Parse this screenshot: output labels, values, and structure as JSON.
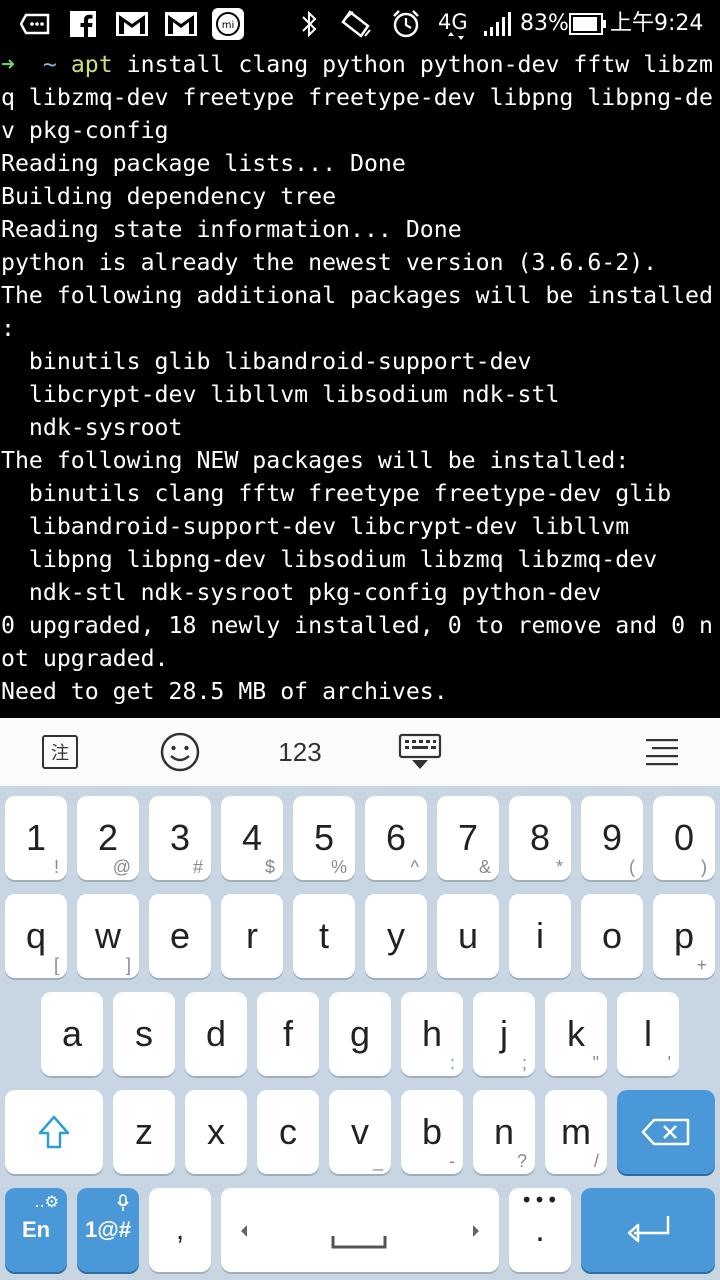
{
  "status_bar": {
    "icons": [
      "message-icon",
      "facebook-icon",
      "gmail-icon",
      "gmail-icon",
      "mi-icon",
      "bluetooth-icon",
      "rotate-icon",
      "alarm-icon"
    ],
    "network": "4G",
    "battery": "83%",
    "time": "上午9:24"
  },
  "terminal": {
    "prompt_arrow": "➜",
    "prompt_dir": "~",
    "command_name": "apt",
    "command_rest": " install clang python python-dev fftw libzm",
    "lines": [
      "q libzmq-dev freetype freetype-dev libpng libpng-de",
      "v pkg-config",
      "Reading package lists... Done",
      "Building dependency tree",
      "Reading state information... Done",
      "python is already the newest version (3.6.6-2).",
      "The following additional packages will be installed",
      ":",
      "  binutils glib libandroid-support-dev",
      "  libcrypt-dev libllvm libsodium ndk-stl",
      "  ndk-sysroot",
      "The following NEW packages will be installed:",
      "  binutils clang fftw freetype freetype-dev glib",
      "  libandroid-support-dev libcrypt-dev libllvm",
      "  libpng libpng-dev libsodium libzmq libzmq-dev",
      "  ndk-stl ndk-sysroot pkg-config python-dev",
      "0 upgraded, 18 newly installed, 0 to remove and 0 n",
      "ot upgraded.",
      "Need to get 28.5 MB of archives."
    ]
  },
  "toolbar": {
    "annotate_label": "注",
    "numbers_label": "123"
  },
  "keyboard": {
    "row1": [
      {
        "main": "1",
        "sub": "!"
      },
      {
        "main": "2",
        "sub": "@"
      },
      {
        "main": "3",
        "sub": "#"
      },
      {
        "main": "4",
        "sub": "$"
      },
      {
        "main": "5",
        "sub": "%"
      },
      {
        "main": "6",
        "sub": "^"
      },
      {
        "main": "7",
        "sub": "&"
      },
      {
        "main": "8",
        "sub": "*"
      },
      {
        "main": "9",
        "sub": "("
      },
      {
        "main": "0",
        "sub": ")"
      }
    ],
    "row2": [
      {
        "main": "q",
        "sub": "["
      },
      {
        "main": "w",
        "sub": "]"
      },
      {
        "main": "e",
        "sub": ""
      },
      {
        "main": "r",
        "sub": ""
      },
      {
        "main": "t",
        "sub": ""
      },
      {
        "main": "y",
        "sub": ""
      },
      {
        "main": "u",
        "sub": ""
      },
      {
        "main": "i",
        "sub": ""
      },
      {
        "main": "o",
        "sub": ""
      },
      {
        "main": "p",
        "sub": "+"
      }
    ],
    "row3": [
      {
        "main": "a",
        "sub": ""
      },
      {
        "main": "s",
        "sub": ""
      },
      {
        "main": "d",
        "sub": ""
      },
      {
        "main": "f",
        "sub": ""
      },
      {
        "main": "g",
        "sub": ""
      },
      {
        "main": "h",
        "sub": ":"
      },
      {
        "main": "j",
        "sub": ";"
      },
      {
        "main": "k",
        "sub": "\""
      },
      {
        "main": "l",
        "sub": "'"
      }
    ],
    "row4": [
      {
        "main": "z",
        "sub": ""
      },
      {
        "main": "x",
        "sub": ""
      },
      {
        "main": "c",
        "sub": ""
      },
      {
        "main": "v",
        "sub": "_"
      },
      {
        "main": "b",
        "sub": "-"
      },
      {
        "main": "n",
        "sub": "?"
      },
      {
        "main": "m",
        "sub": "/"
      }
    ],
    "lang_label": "En",
    "symbols_label": "1@#",
    "comma_label": ",",
    "period_label": "."
  }
}
